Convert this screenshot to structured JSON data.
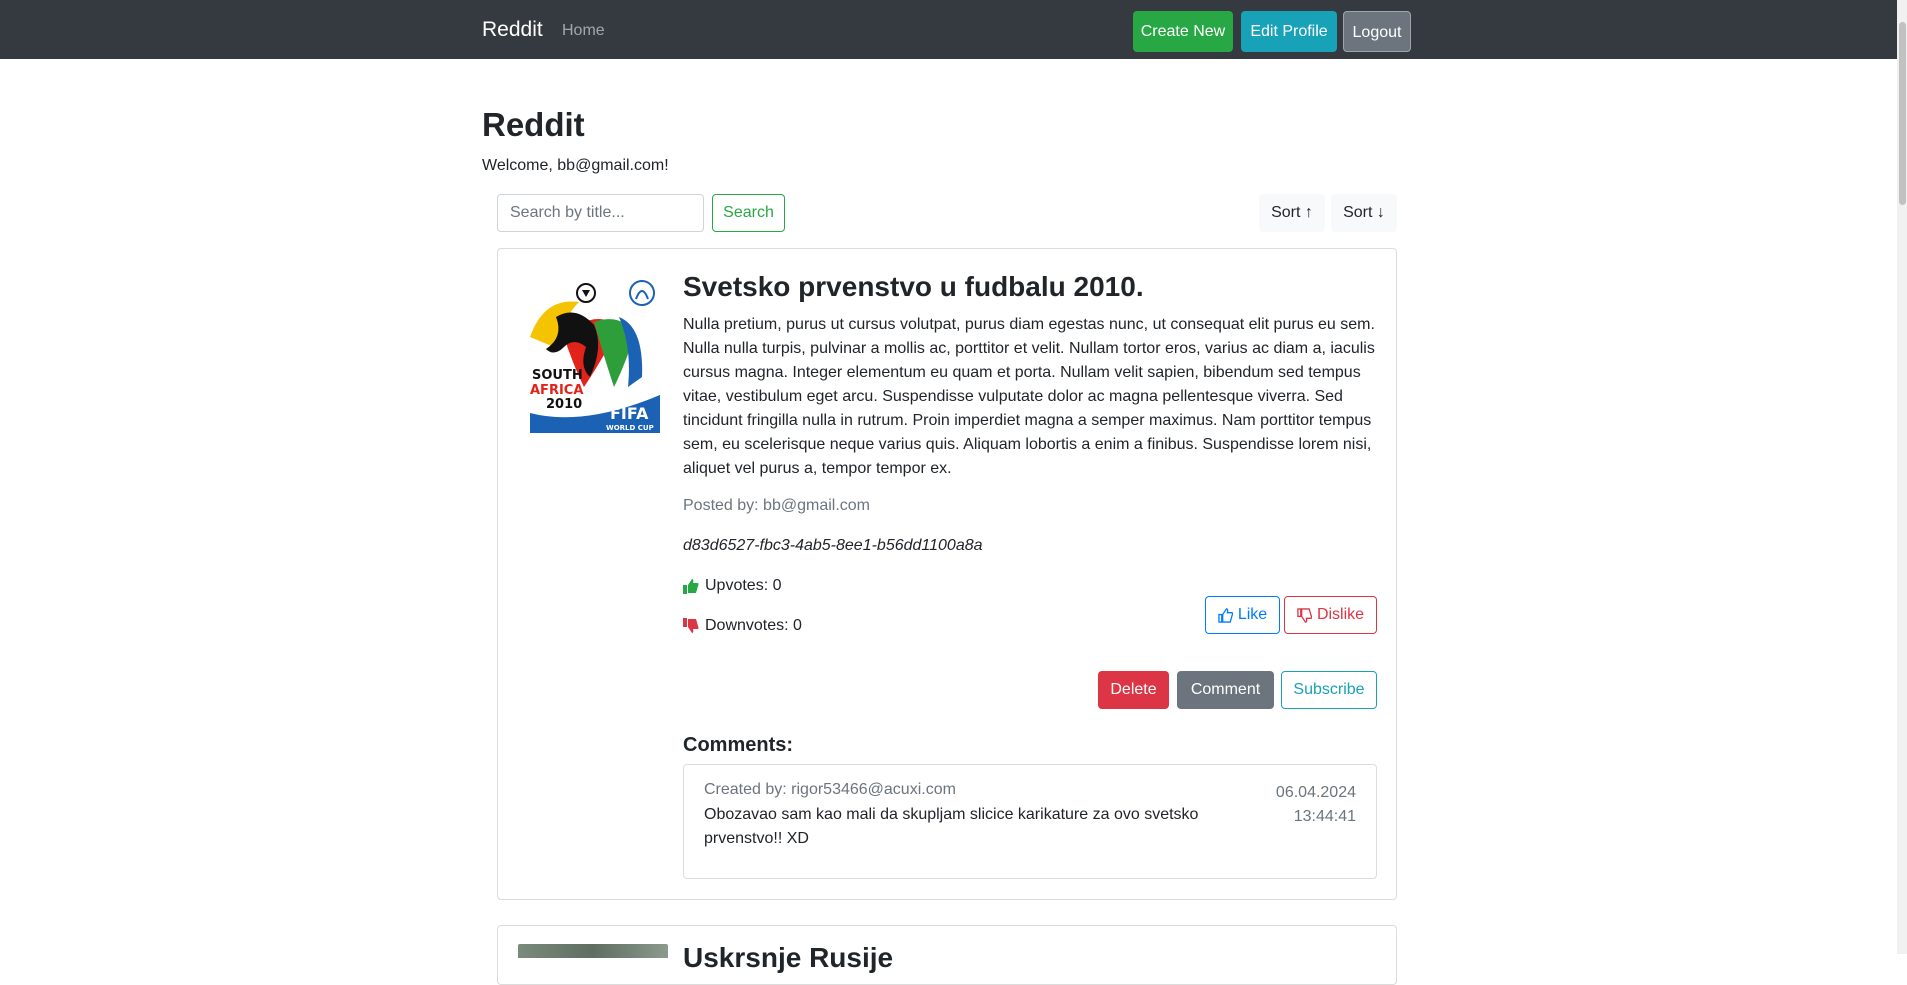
{
  "navbar": {
    "brand": "Reddit",
    "home": "Home",
    "create_new": "Create New",
    "edit_profile": "Edit Profile",
    "logout": "Logout"
  },
  "page": {
    "title": "Reddit",
    "welcome": "Welcome, bb@gmail.com!"
  },
  "toolbar": {
    "search_placeholder": "Search by title...",
    "search_label": "Search",
    "sort_asc": "Sort ↑",
    "sort_desc": "Sort ↓"
  },
  "posts": [
    {
      "image_label": "SOUTH AFRICA 2010 FIFA WORLD CUP",
      "title": "Svetsko prvenstvo u fudbalu 2010.",
      "body": "Nulla pretium, purus ut cursus volutpat, purus diam egestas nunc, ut consequat elit purus eu sem. Nulla nulla turpis, pulvinar a mollis ac, porttitor et velit. Nullam tortor eros, varius ac diam a, iaculis cursus magna. Integer elementum eu quam et porta. Nullam velit sapien, bibendum sed tempus vitae, vestibulum eget arcu. Suspendisse vulputate dolor ac magna pellentesque viverra. Sed tincidunt fringilla nulla in rutrum. Proin imperdiet magna a semper maximus. Nam porttitor tempus sem, eu scelerisque neque varius quis. Aliquam lobortis a enim a finibus. Suspendisse lorem nisi, aliquet vel purus a, tempor tempor ex.",
      "posted_by": "Posted by: bb@gmail.com",
      "id": "d83d6527-fbc3-4ab5-8ee1-b56dd1100a8a",
      "upvotes": "Upvotes: 0",
      "downvotes": "Downvotes: 0",
      "like_label": "Like",
      "dislike_label": "Dislike",
      "delete_label": "Delete",
      "comment_label": "Comment",
      "subscribe_label": "Subscribe",
      "comments_heading": "Comments:",
      "comments": [
        {
          "author": "Created by: rigor53466@acuxi.com",
          "date": "06.04.2024",
          "time": "13:44:41",
          "text": "Obozavao sam kao mali da skupljam slicice karikature za ovo svetsko prvenstvo!! XD"
        }
      ]
    },
    {
      "title": "Uskrsnje Rusije"
    }
  ],
  "colors": {
    "navbar_bg": "#343a40",
    "success": "#28a745",
    "info": "#17a2b8",
    "secondary": "#6c757d",
    "primary": "#007bff",
    "danger": "#dc3545"
  },
  "icons": {
    "upvote": "thumbs-up-icon",
    "downvote": "thumbs-down-icon",
    "like": "thumbs-up-outline-icon",
    "dislike": "thumbs-down-outline-icon"
  }
}
